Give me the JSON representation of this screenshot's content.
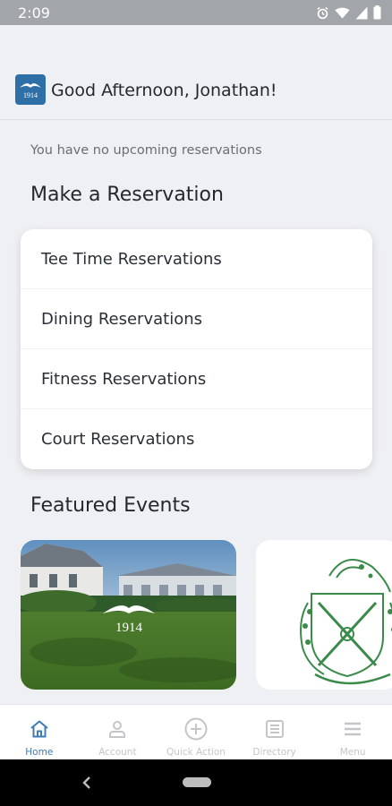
{
  "status_bar": {
    "time": "2:09"
  },
  "header": {
    "greeting": "Good Afternoon, Jonathan!",
    "logo_text": "1914"
  },
  "reservations": {
    "empty_message": "You have no upcoming reservations",
    "section_title": "Make a Reservation",
    "items": [
      {
        "label": "Tee Time Reservations"
      },
      {
        "label": "Dining Reservations"
      },
      {
        "label": "Fitness Reservations"
      },
      {
        "label": "Court Reservations"
      }
    ]
  },
  "events": {
    "section_title": "Featured Events",
    "cards": [
      {
        "overlay_text": "1914"
      },
      {
        "overlay_text": ""
      }
    ]
  },
  "tab_bar": {
    "tabs": [
      {
        "label": "Home",
        "icon": "home-icon",
        "active": true
      },
      {
        "label": "Account",
        "icon": "account-icon",
        "active": false
      },
      {
        "label": "Quick Action",
        "icon": "plus-circle-icon",
        "active": false
      },
      {
        "label": "Directory",
        "icon": "directory-icon",
        "active": false
      },
      {
        "label": "Menu",
        "icon": "menu-icon",
        "active": false
      }
    ]
  },
  "colors": {
    "accent": "#3d7cb8",
    "logo_bg": "#2d6fa6",
    "crest_green": "#3a8a4a"
  }
}
